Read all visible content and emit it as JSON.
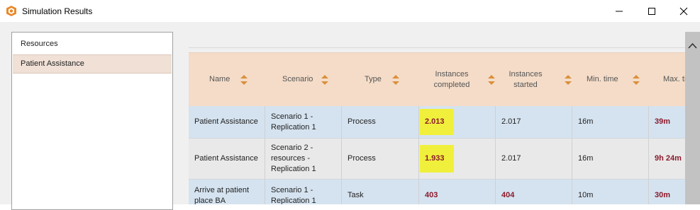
{
  "window": {
    "title": "Simulation Results"
  },
  "sidebar": {
    "items": [
      {
        "label": "Resources"
      },
      {
        "label": "Patient Assistance"
      }
    ]
  },
  "table": {
    "columns": [
      {
        "label": "Name"
      },
      {
        "label": "Scenario"
      },
      {
        "label": "Type"
      },
      {
        "label": "Instances\ncompleted"
      },
      {
        "label": "Instances\nstarted"
      },
      {
        "label": "Min. time"
      },
      {
        "label": "Max. ti"
      }
    ],
    "rows": [
      {
        "name": "Patient Assistance",
        "scenario": "Scenario 1 -\nReplication 1",
        "type": "Process",
        "completed": "2.013",
        "started": "2.017",
        "min_time": "16m",
        "max_time": "39m"
      },
      {
        "name": "Patient Assistance",
        "scenario": "Scenario 2 -\nresources -\nReplication 1",
        "type": "Process",
        "completed": "1.933",
        "started": "2.017",
        "min_time": "16m",
        "max_time": "9h 24m"
      },
      {
        "name": "Arrive at patient\nplace BA",
        "scenario": "Scenario 1 -\nReplication 1",
        "type": "Task",
        "completed": "403",
        "started": "404",
        "min_time": "10m",
        "max_time": "30m"
      }
    ]
  },
  "colors": {
    "header_bg": "#f4dcc8",
    "row_blue": "#d5e3f0",
    "row_grey": "#e9e9e9",
    "highlight": "#f0f03c",
    "value_red": "#8b1a2b",
    "sort_orange": "#d9903a",
    "sidebar_selected": "#f0e0d6"
  }
}
